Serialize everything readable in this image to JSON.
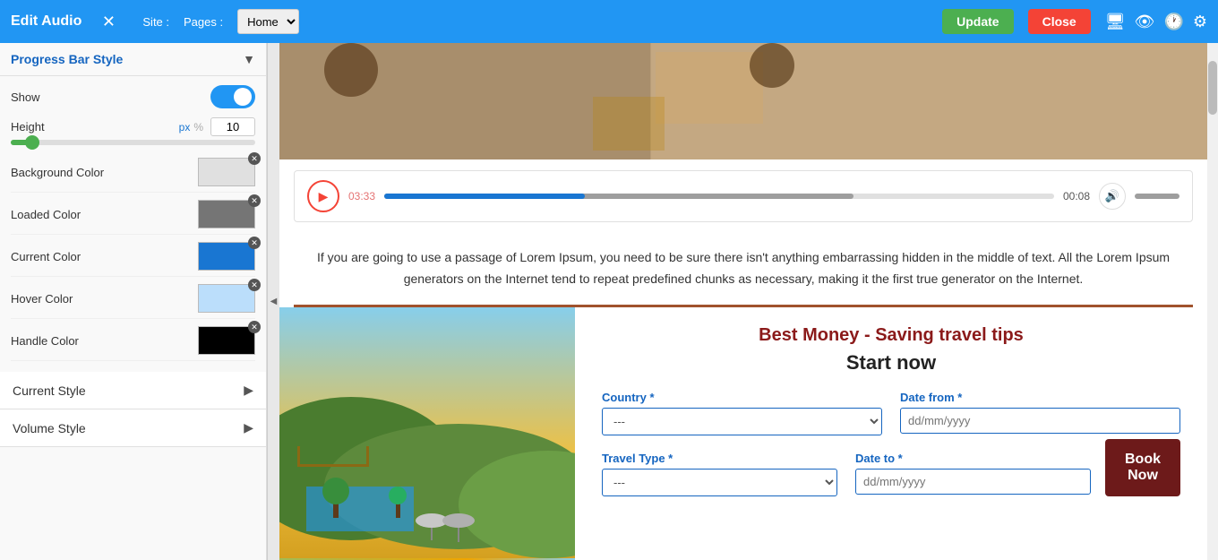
{
  "topbar": {
    "title": "Edit Audio",
    "close_symbol": "✕",
    "site_label": "Site :",
    "pages_label": "Pages :",
    "pages_options": [
      "Home"
    ],
    "pages_selected": "Home",
    "update_label": "Update",
    "close_label": "Close"
  },
  "sidebar": {
    "progress_bar_style_label": "Progress Bar Style",
    "show_label": "Show",
    "height_label": "Height",
    "height_value": "10",
    "height_unit_px": "px",
    "height_unit_pct": "%",
    "bg_color_label": "Background Color",
    "loaded_color_label": "Loaded Color",
    "current_color_label": "Current Color",
    "hover_color_label": "Hover Color",
    "handle_color_label": "Handle Color",
    "current_style_label": "Current Style",
    "volume_style_label": "Volume Style",
    "colors": {
      "background": "#e0e0e0",
      "loaded": "#757575",
      "current": "#1976d2",
      "hover": "#bbdefb",
      "handle": "#000000"
    }
  },
  "audio_player": {
    "time_current": "03:33",
    "time_total": "00:08"
  },
  "lorem": {
    "text": "If you are going to use a passage of Lorem Ipsum, you need to be sure there isn't anything embarrassing hidden in the middle of text. All the Lorem Ipsum generators on the Internet tend to repeat predefined chunks as necessary, making it the first true generator on the Internet."
  },
  "travel": {
    "title": "Best Money - Saving travel tips",
    "subtitle": "Start now",
    "country_label": "Country *",
    "country_placeholder": "---",
    "date_from_label": "Date from *",
    "date_from_placeholder": "dd/mm/yyyy",
    "travel_type_label": "Travel Type *",
    "travel_type_placeholder": "---",
    "date_to_label": "Date to *",
    "date_to_placeholder": "dd/mm/yyyy",
    "book_label": "Book\nNow"
  }
}
